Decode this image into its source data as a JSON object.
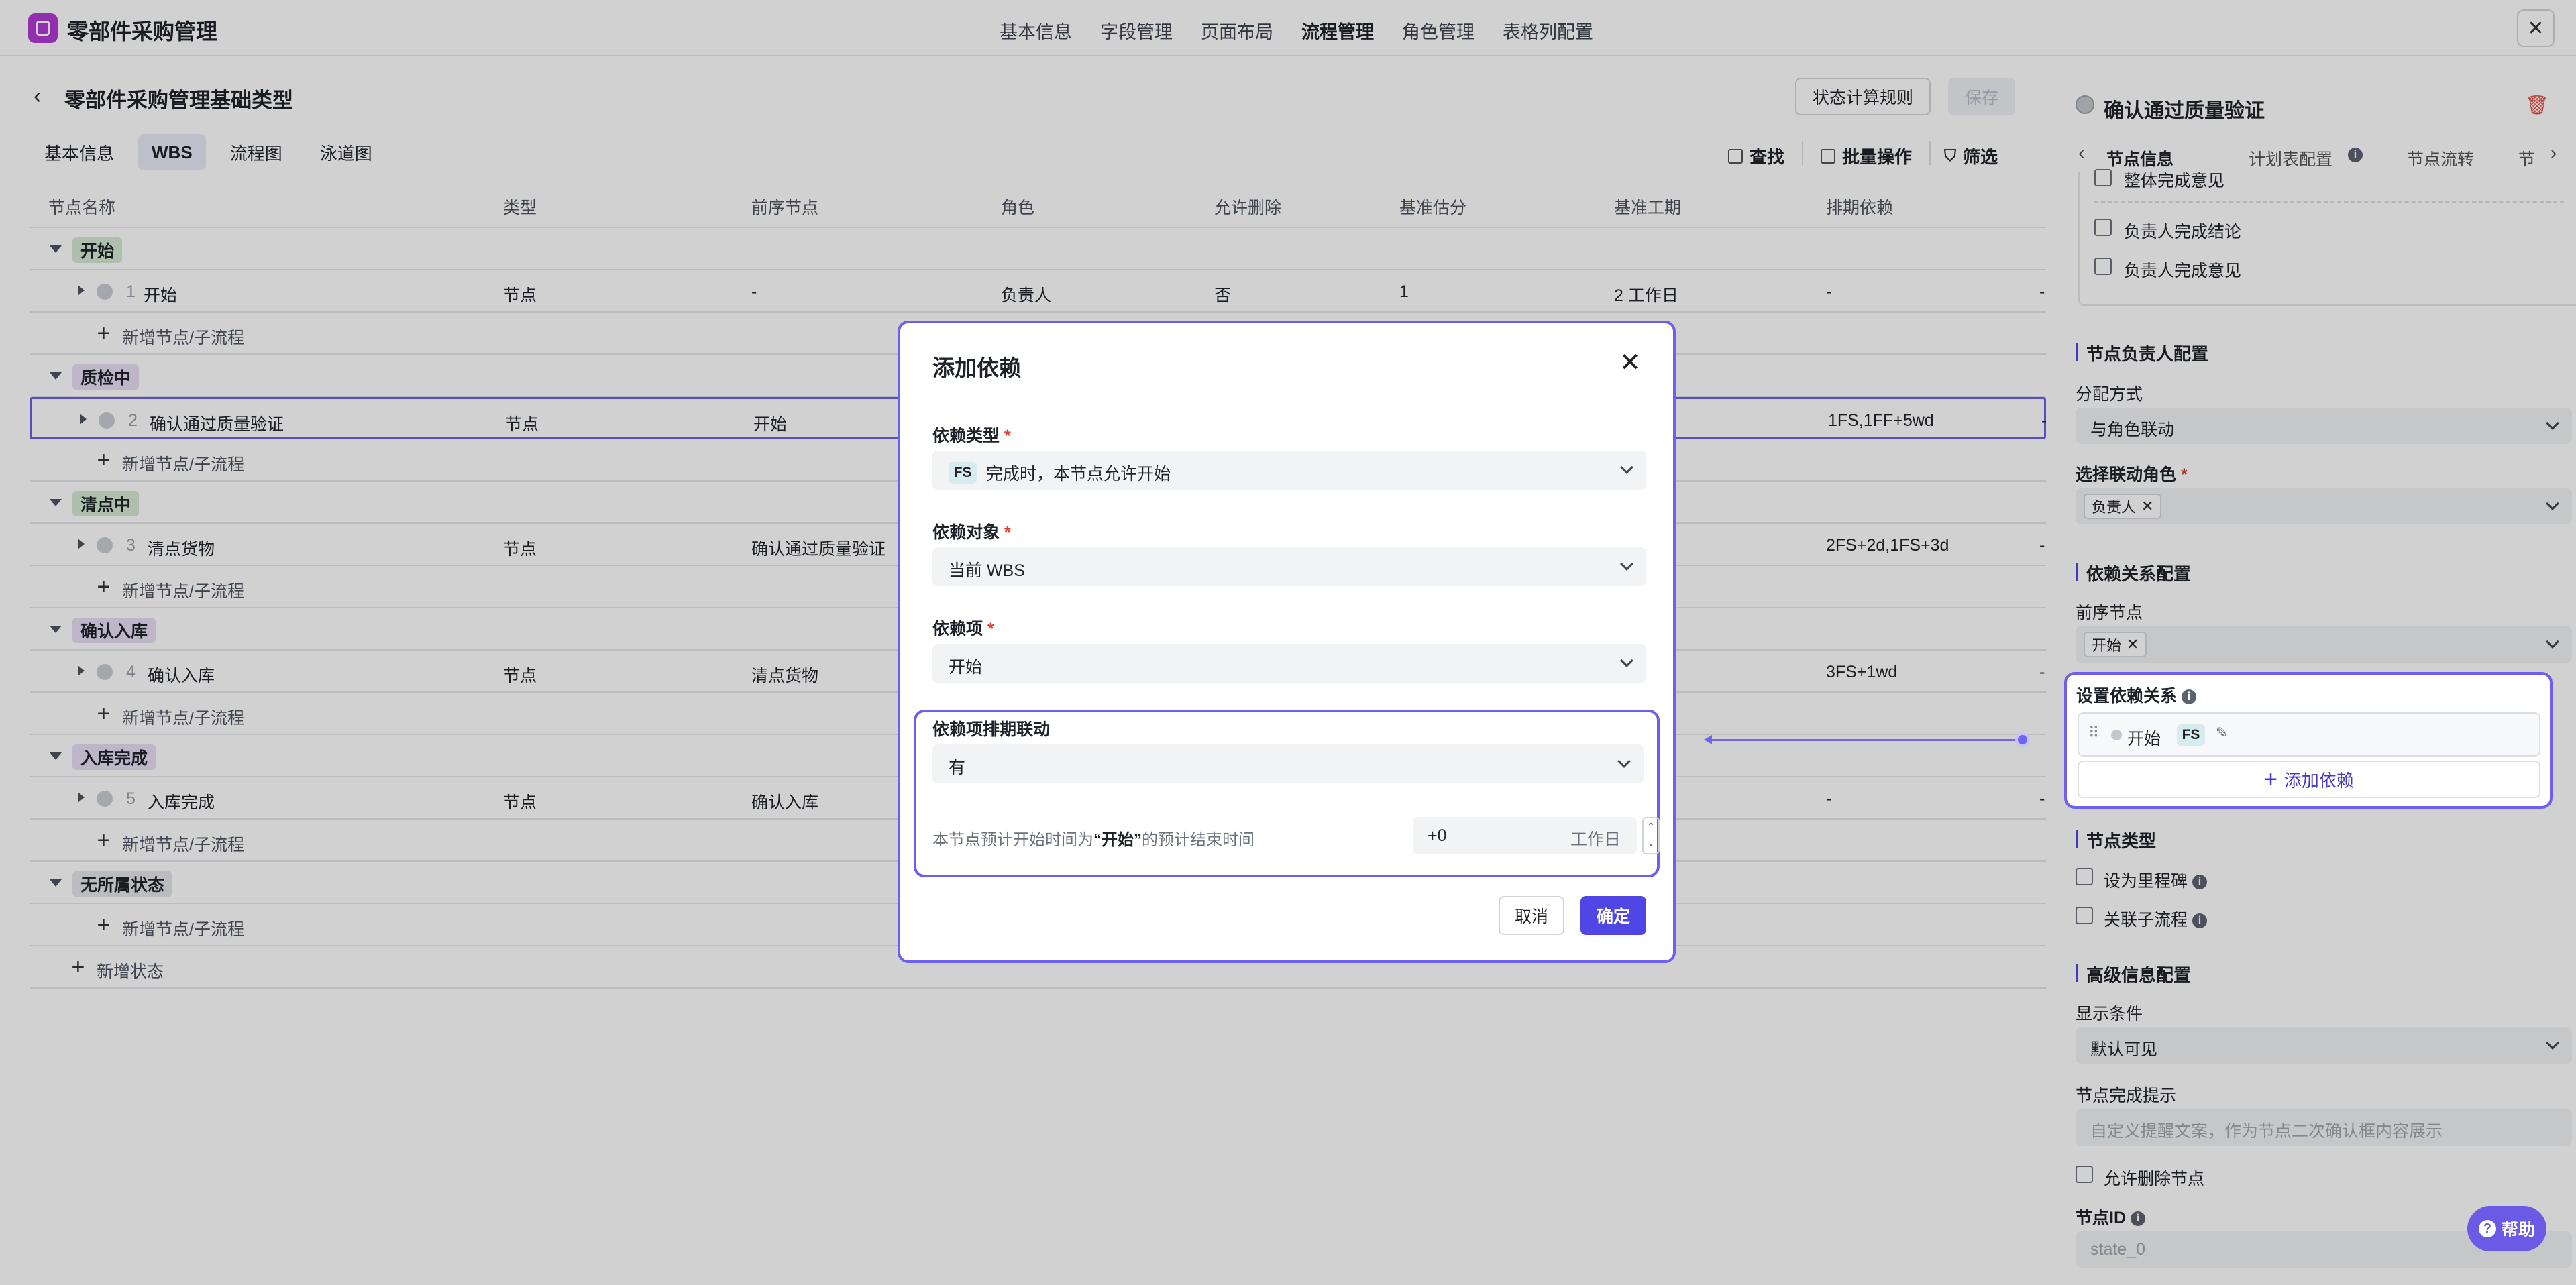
{
  "app": {
    "title": "零部件采购管理"
  },
  "top_nav": [
    "基本信息",
    "字段管理",
    "页面布局",
    "流程管理",
    "角色管理",
    "表格列配置"
  ],
  "top_nav_active": 3,
  "page": {
    "title": "零部件采购管理基础类型",
    "status_rule_button": "状态计算规则",
    "save_button": "保存"
  },
  "tabs": [
    "基本信息",
    "WBS",
    "流程图",
    "泳道图"
  ],
  "toolbar": {
    "find": "查找",
    "batch": "批量操作",
    "filter": "筛选"
  },
  "columns": [
    "节点名称",
    "类型",
    "前序节点",
    "角色",
    "允许删除",
    "基准估分",
    "基准工期",
    "排期依赖"
  ],
  "groups": [
    {
      "name": "开始",
      "color": "#d6ead4",
      "node": {
        "index": "1",
        "name": "开始",
        "type": "节点",
        "pred": "-",
        "role": "负责人",
        "deletable": "否",
        "estimate": "1",
        "duration": "2 工作日",
        "dep": "-",
        "extra": "-"
      },
      "add": "新增节点/子流程"
    },
    {
      "name": "质检中",
      "color": "#e6def4",
      "node": {
        "index": "2",
        "name": "确认通过质量验证",
        "type": "节点",
        "pred": "开始",
        "dep": "1FS,1FF+5wd",
        "extra": "-"
      },
      "add": "新增节点/子流程"
    },
    {
      "name": "清点中",
      "color": "#d6ead4",
      "node": {
        "index": "3",
        "name": "清点货物",
        "type": "节点",
        "pred": "确认通过质量验证",
        "dep": "2FS+2d,1FS+3d",
        "extra": "-"
      },
      "add": "新增节点/子流程"
    },
    {
      "name": "确认入库",
      "color": "#e6def4",
      "node": {
        "index": "4",
        "name": "确认入库",
        "type": "节点",
        "pred": "清点货物",
        "dep": "3FS+1wd",
        "extra": "-"
      },
      "add": "新增节点/子流程"
    },
    {
      "name": "入库完成",
      "color": "#e6def4",
      "node": {
        "index": "5",
        "name": "入库完成",
        "type": "节点",
        "pred": "确认入库",
        "dep": "-",
        "extra": "-"
      },
      "add": "新增节点/子流程"
    },
    {
      "name": "无所属状态",
      "color": "#e4e6ea",
      "add": "新增节点/子流程"
    }
  ],
  "add_state": "新增状态",
  "modal": {
    "title": "添加依赖",
    "dep_type_label": "依赖类型",
    "dep_type_badge": "FS",
    "dep_type_value": "完成时，本节点允许开始",
    "dep_target_label": "依赖对象",
    "dep_target_value": "当前 WBS",
    "dep_item_label": "依赖项",
    "dep_item_value": "开始",
    "link_label": "依赖项排期联动",
    "link_value": "有",
    "desc_prefix": "本节点预计开始时间为",
    "desc_name": "“开始”",
    "desc_suffix": "的预计结束时间",
    "offset_value": "+0",
    "offset_unit": "工作日",
    "cancel": "取消",
    "ok": "确定",
    "required_mark": "*"
  },
  "right_panel": {
    "title": "确认通过质量验证",
    "tabs": [
      "节点信息",
      "计划表配置",
      "节点流转",
      "节"
    ],
    "checkbox_items": [
      "整体完成意见",
      "负责人完成结论",
      "负责人完成意见"
    ],
    "owner_section": "节点负责人配置",
    "assign_label": "分配方式",
    "assign_value": "与角色联动",
    "role_label": "选择联动角色",
    "role_tag": "负责人",
    "dep_section": "依赖关系配置",
    "pred_label": "前序节点",
    "pred_tag": "开始",
    "set_dep_label": "设置依赖关系",
    "dep_item_name": "开始",
    "dep_item_badge": "FS",
    "add_dep": "添加依赖",
    "node_type_section": "节点类型",
    "milestone": "设为里程碑",
    "link_subflow": "关联子流程",
    "adv_section": "高级信息配置",
    "display_label": "显示条件",
    "display_value": "默认可见",
    "tip_label": "节点完成提示",
    "tip_placeholder": "自定义提醒文案，作为节点二次确认框内容展示",
    "allow_delete": "允许删除节点",
    "node_id_label": "节点ID",
    "node_id_placeholder": "state_0"
  },
  "help": "帮助"
}
